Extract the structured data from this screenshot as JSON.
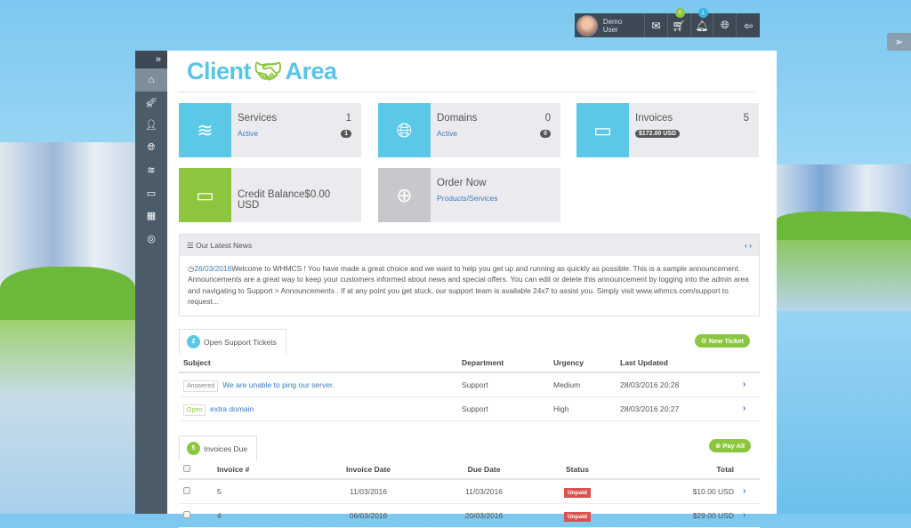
{
  "topbar": {
    "user_name": "Demo User",
    "cart_count": "0",
    "notification_count": "1"
  },
  "logo": {
    "left": "Client",
    "right": "Area"
  },
  "cards": {
    "services": {
      "title": "Services",
      "sub": "Active",
      "count": "1",
      "badge": "1"
    },
    "domains": {
      "title": "Domains",
      "sub": "Active",
      "count": "0",
      "badge": "0"
    },
    "invoices": {
      "title": "Invoices",
      "count": "5",
      "badge": "$172.00 USD"
    },
    "credit": {
      "title": "Credit Balance$0.00 USD"
    },
    "order": {
      "title": "Order Now",
      "sub": "Products/Services"
    }
  },
  "news": {
    "title": "Our Latest News",
    "date": "26/03/2016",
    "text": "Welcome to WHMCS ! You have made a great choice and we want to help you get up and running as quickly as possible. This is a sample announcement. Announcements are a great way to keep your customers informed about news and special offers. You can edit or delete this announcement by logging into the admin area and navigating to Support > Announcements . If at any point you get stuck, our support team is available 24x7 to assist you. Simply visit www.whmcs.com/support to request..."
  },
  "tickets": {
    "count": "2",
    "title": "Open Support Tickets",
    "new_label": "New Ticket",
    "headers": [
      "Subject",
      "Department",
      "Urgency",
      "Last Updated"
    ],
    "rows": [
      {
        "status": "Answered",
        "subject": "We are unable to ping our server.",
        "department": "Support",
        "urgency": "Medium",
        "updated": "28/03/2016 20:28"
      },
      {
        "status": "Open",
        "subject": "extra domain",
        "department": "Support",
        "urgency": "High",
        "updated": "28/03/2016 20:27"
      }
    ]
  },
  "invoices": {
    "count": "5",
    "title": "Invoices Due",
    "pay_label": "Pay All",
    "headers": [
      "Invoice #",
      "Invoice Date",
      "Due Date",
      "Status",
      "Total"
    ],
    "rows": [
      {
        "num": "5",
        "date": "11/03/2016",
        "due": "11/03/2016",
        "status": "Unpaid",
        "total": "$10.00 USD"
      },
      {
        "num": "4",
        "date": "06/03/2016",
        "due": "20/03/2016",
        "status": "Unpaid",
        "total": "$29.00 USD"
      }
    ]
  }
}
